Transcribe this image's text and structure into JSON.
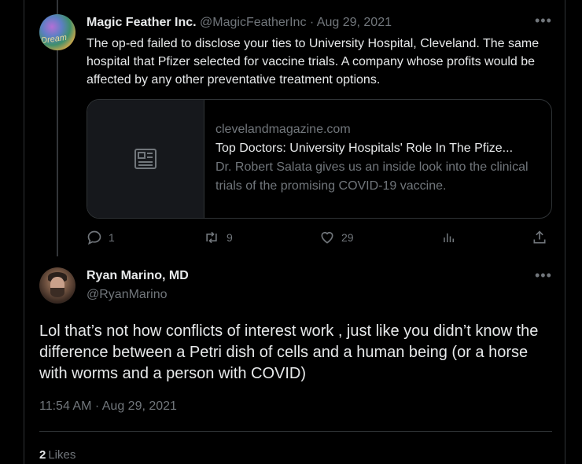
{
  "reply_tweet": {
    "author_name": "Magic Feather Inc.",
    "author_handle": "@MagicFeatherInc",
    "separator": "·",
    "date": "Aug 29, 2021",
    "avatar_text": "Dream",
    "text": "The op-ed failed to disclose your ties to University Hospital, Cleveland. The same hospital that Pfizer selected for vaccine trials. A company whose profits would be affected by any other preventative treatment options.",
    "card": {
      "domain": "clevelandmagazine.com",
      "title": "Top Doctors: University Hospitals' Role In The Pfize...",
      "description": "Dr. Robert Salata gives us an inside look into the clinical trials of the promising COVID-19 vaccine.",
      "thumb_icon": "article-icon"
    },
    "actions": {
      "replies": "1",
      "retweets": "9",
      "likes": "29",
      "views": "",
      "reply_icon": "reply-icon",
      "retweet_icon": "retweet-icon",
      "like_icon": "heart-icon",
      "views_icon": "analytics-icon",
      "share_icon": "share-icon"
    },
    "more_icon": "more-icon"
  },
  "main_tweet": {
    "author_name": "Ryan Marino, MD",
    "author_handle": "@RyanMarino",
    "text": "Lol that’s not how conflicts of interest work , just like you didn’t know the difference between a Petri dish of cells and a human being (or a horse with worms and a person with COVID)",
    "timestamp": "11:54 AM · Aug 29, 2021",
    "likes_count": "2",
    "likes_label": "Likes",
    "more_icon": "more-icon"
  },
  "colors": {
    "background": "#000000",
    "text": "#e7e9ea",
    "muted": "#71767b",
    "border": "#2f3336"
  }
}
